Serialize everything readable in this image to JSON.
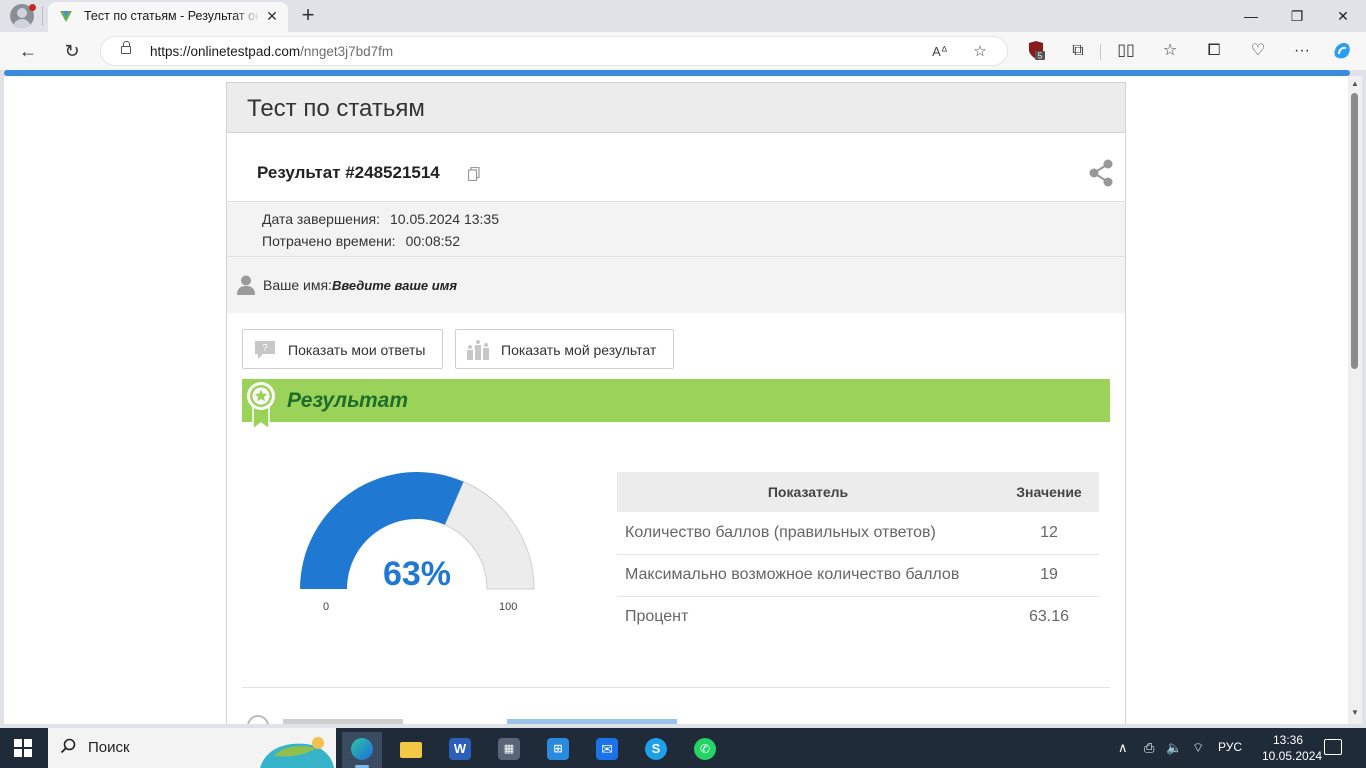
{
  "browser": {
    "tab_title": "Тест по статьям - Результат онлайн",
    "tab_close": "✕",
    "new_tab": "+",
    "url_host": "https://onlinetestpad.com",
    "url_path": "/nnget3j7bd7fm",
    "extension_badge": "5",
    "window_controls": {
      "minimize": "—",
      "restore": "❐",
      "close": "✕"
    }
  },
  "page": {
    "title": "Тест по статьям",
    "result_id": "Результат #248521514",
    "completion_label": "Дата завершения:",
    "completion_value": "10.05.2024 13:35",
    "time_label": "Потрачено времени:",
    "time_value": "00:08:52",
    "name_label": "Ваше имя:",
    "name_value": "Введите ваше имя",
    "btn_show_answers": "Показать мои ответы",
    "btn_show_result": "Показать мой результат",
    "result_heading": "Результат",
    "gauge": {
      "percent": 63,
      "label": "63%",
      "min": "0",
      "max": "100"
    },
    "table": {
      "headers": [
        "Показатель",
        "Значение"
      ],
      "rows": [
        {
          "name": "Количество баллов (правильных ответов)",
          "value": "12"
        },
        {
          "name": "Максимально возможное количество баллов",
          "value": "19"
        },
        {
          "name": "Процент",
          "value": "63.16"
        }
      ]
    }
  },
  "colors": {
    "accent": "#1f78d1",
    "result_bar": "#9bd35a",
    "result_text": "#1e6e2a",
    "browser_progress": "#3a8be0"
  },
  "taskbar": {
    "search_placeholder": "Поиск",
    "language": "РУС",
    "time": "13:36",
    "date": "10.05.2024"
  }
}
